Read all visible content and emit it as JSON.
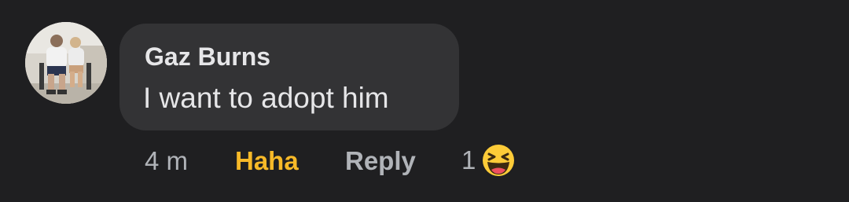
{
  "comment": {
    "author": "Gaz Burns",
    "text": "I want to adopt him",
    "time": "4 m",
    "reaction_label": "Haha",
    "reply_label": "Reply",
    "reaction_count": "1",
    "reaction_icon": "haha-emoji-icon"
  },
  "colors": {
    "background": "#1f1f21",
    "bubble": "#333335",
    "text": "#e6e6e8",
    "muted": "#b0b3b8",
    "haha": "#f7b928"
  }
}
